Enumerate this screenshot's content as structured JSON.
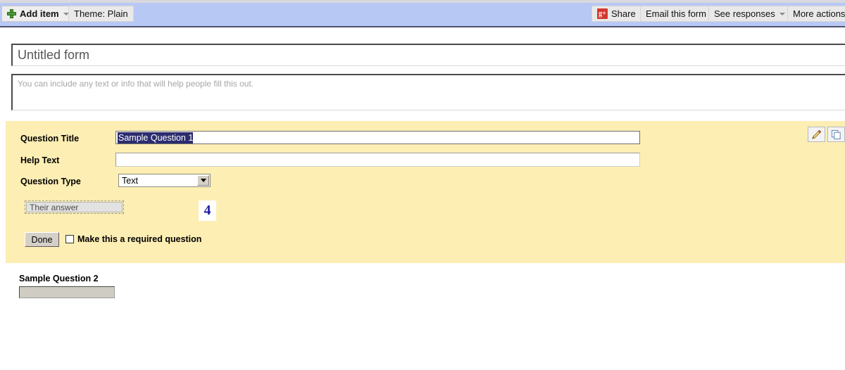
{
  "toolbar": {
    "add_item": {
      "label": "Add item",
      "icon": "plus-icon",
      "caret": true
    },
    "theme": {
      "label": "Theme:  Plain"
    },
    "share": {
      "label": "Share",
      "icon": "google-plus-icon"
    },
    "email_this_form": {
      "label": "Email this form"
    },
    "see_responses": {
      "label": "See responses",
      "caret": true
    },
    "more_actions": {
      "label": "More actions"
    }
  },
  "form": {
    "title": "Untitled form",
    "description_placeholder": "You can include any text or info that will help people fill this out."
  },
  "question_editor": {
    "labels": {
      "question_title": "Question Title",
      "help_text": "Help Text",
      "question_type": "Question Type"
    },
    "question_title_value": "Sample Question 1",
    "help_text_value": "",
    "question_type_value": "Text",
    "answer_preview": "Their answer",
    "annotation": "4",
    "done_label": "Done",
    "required_label": "Make this a required question",
    "required_checked": false,
    "icons": {
      "edit": "pencil-icon",
      "duplicate": "duplicate-icon"
    }
  },
  "questions": [
    {
      "title": "Sample Question 2",
      "answer_value": ""
    }
  ],
  "colors": {
    "toolbar_bg": "#b8c8f5",
    "panel_bg": "#fdeeb4",
    "selection_bg": "#2c2c6e",
    "annotation": "#1c1ca8",
    "gplus_red": "#d4382c",
    "plus_green": "#4d9b37"
  }
}
